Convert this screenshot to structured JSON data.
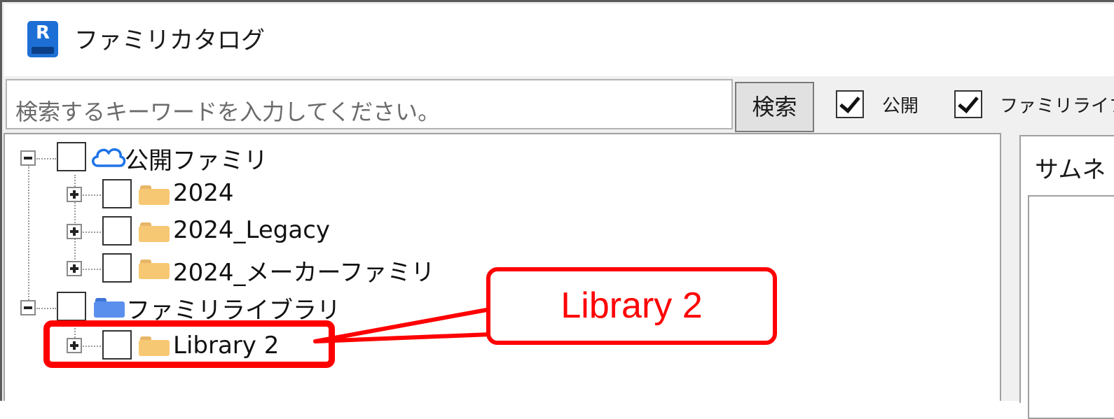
{
  "window": {
    "title": "ファミリカタログ",
    "app_icon_letter": "R"
  },
  "search": {
    "placeholder": "検索するキーワードを入力してください。",
    "button_label": "検索"
  },
  "filters": [
    {
      "label": "公開",
      "checked": true
    },
    {
      "label": "ファミリライブ",
      "checked": true
    }
  ],
  "tree": {
    "roots": [
      {
        "label": "公開ファミリ",
        "icon": "cloud-icon",
        "expanded": true,
        "children": [
          {
            "label": "2024",
            "icon": "folder-icon"
          },
          {
            "label": "2024_Legacy",
            "icon": "folder-icon"
          },
          {
            "label": "2024_メーカーファミリ",
            "icon": "folder-icon"
          }
        ]
      },
      {
        "label": "ファミリライブラリ",
        "icon": "folder-icon",
        "expanded": true,
        "children": [
          {
            "label": "Library 2",
            "icon": "folder-icon"
          }
        ]
      }
    ]
  },
  "right_panel": {
    "label": "サムネ"
  },
  "annotation": {
    "callout_text": "Library 2",
    "color": "#ff0000"
  }
}
